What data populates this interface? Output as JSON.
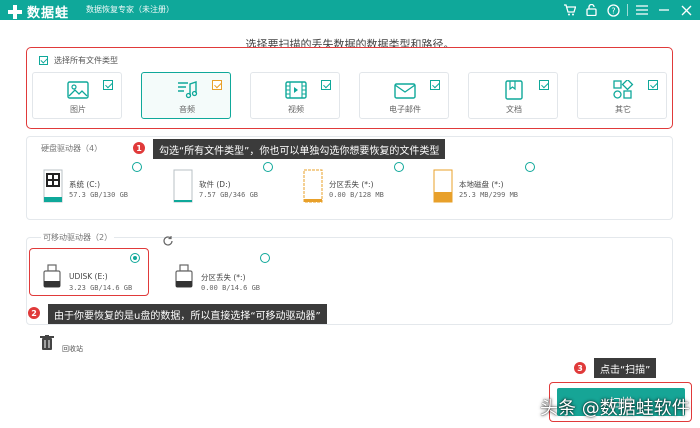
{
  "app": {
    "logo_text": "数据蛙",
    "subtitle": "数据恢复专家（未注册）",
    "brand_color": "#0fa89a"
  },
  "toolbar_icons": [
    "cart-icon",
    "unlock-icon",
    "help-icon",
    "menu-icon",
    "minimize-icon",
    "close-icon"
  ],
  "page": {
    "heading": "选择要扫描的丢失数据的数据类型和路径。"
  },
  "file_types": {
    "select_all_label": "选择所有文件类型",
    "select_all_checked": true,
    "items": [
      {
        "label": "图片",
        "icon": "image-icon",
        "checked": true
      },
      {
        "label": "音频",
        "icon": "audio-icon",
        "checked": true,
        "selected": true
      },
      {
        "label": "视频",
        "icon": "video-icon",
        "checked": true
      },
      {
        "label": "电子邮件",
        "icon": "email-icon",
        "checked": true
      },
      {
        "label": "文档",
        "icon": "document-icon",
        "checked": true
      },
      {
        "label": "其它",
        "icon": "other-icon",
        "checked": true
      }
    ]
  },
  "hard_drives": {
    "title": "硬盘驱动器（4）",
    "items": [
      {
        "name": "系统 (C:)",
        "size": "57.3 GB/130 GB",
        "icon": "windows-drive-icon"
      },
      {
        "name": "软件 (D:)",
        "size": "7.57 GB/346 GB",
        "icon": "drive-icon"
      },
      {
        "name": "分区丢失 (*:)",
        "size": "0.00  B/128 MB",
        "icon": "lost-partition-icon"
      },
      {
        "name": "本地磁盘 (*:)",
        "size": "25.3 MB/299 MB",
        "icon": "local-disk-icon"
      }
    ]
  },
  "removable_drives": {
    "title": "可移动驱动器（2）",
    "refresh_icon": "refresh-icon",
    "items": [
      {
        "name": "UDISK (E:)",
        "size": "3.23 GB/14.6 GB",
        "icon": "usb-drive-icon",
        "selected": true
      },
      {
        "name": "分区丢失 (*:)",
        "size": "0.00  B/14.6 GB",
        "icon": "usb-drive-icon",
        "selected": false
      }
    ]
  },
  "recycle_bin": {
    "label": "回收站",
    "icon": "trash-icon"
  },
  "annotations": [
    {
      "number": "1",
      "text": "勾选“所有文件类型”，你也可以单独勾选你想要恢复的文件类型"
    },
    {
      "number": "2",
      "text": "由于你要恢复的是u盘的数据，所以直接选择“可移动驱动器”"
    },
    {
      "number": "3",
      "text": "点击“扫描”"
    }
  ],
  "scan_button": {
    "label": "扫描"
  },
  "watermark": "头条 @数据蛙软件"
}
